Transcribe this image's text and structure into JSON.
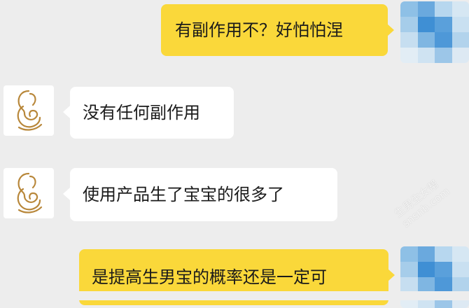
{
  "messages": [
    {
      "side": "out",
      "text": "有副作用不？好怕怕涅"
    },
    {
      "side": "in",
      "text": "没有任何副作用"
    },
    {
      "side": "in",
      "text": "使用产品生了宝宝的很多了"
    },
    {
      "side": "out",
      "text": "是提高生男宝的概率还是一定可"
    }
  ],
  "watermark": {
    "line1": "生男生女帮",
    "line2": "snsnb.com"
  },
  "colors": {
    "outgoing_bubble": "#fad83a",
    "incoming_bubble": "#ffffff",
    "background": "#ededed",
    "logo": "#b8873a"
  },
  "icons": {
    "incoming_avatar": "mother-baby-logo-icon",
    "outgoing_avatar": "pixelated-avatar"
  }
}
